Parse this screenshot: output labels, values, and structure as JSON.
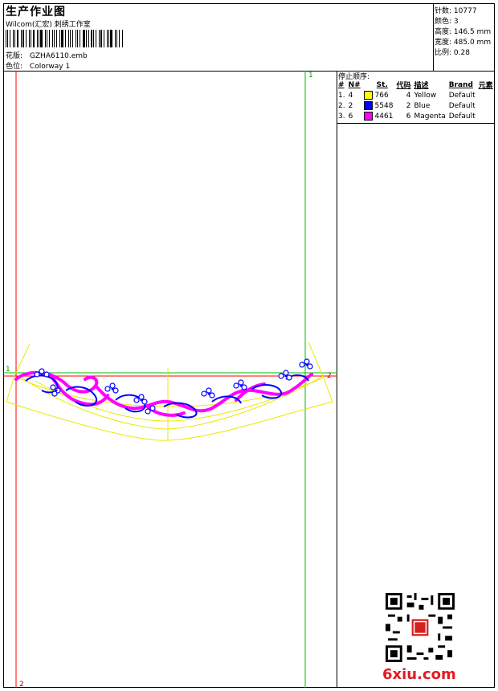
{
  "header": {
    "title": "生产作业图",
    "company": "Wilcom(汇宏) 刺绣工作室",
    "design_label": "花版:",
    "design_value": "GZHA6110.emb",
    "colorway_label": "色位:",
    "colorway_value": "Colorway 1"
  },
  "stats": [
    {
      "label": "针数:",
      "value": "10777"
    },
    {
      "label": "颜色:",
      "value": "3"
    },
    {
      "label": "高度:",
      "value": "146.5 mm"
    },
    {
      "label": "宽度:",
      "value": "485.0 mm"
    },
    {
      "label": "比例:",
      "value": "0.28"
    }
  ],
  "stop_sequence": {
    "title": "停止顺序:",
    "columns": [
      "#",
      "N#",
      "St.",
      "代码",
      "描述",
      "Brand",
      "元素"
    ],
    "rows": [
      {
        "idx": "1.",
        "n": "4",
        "st": "766",
        "code": "4",
        "desc": "Yellow",
        "brand": "Default",
        "color": "#ffff00"
      },
      {
        "idx": "2.",
        "n": "2",
        "st": "5548",
        "code": "2",
        "desc": "Blue",
        "brand": "Default",
        "color": "#0000ff"
      },
      {
        "idx": "3.",
        "n": "6",
        "st": "4461",
        "code": "6",
        "desc": "Magenta",
        "brand": "Default",
        "color": "#ff00ff"
      }
    ]
  },
  "guides": {
    "label_top": "1",
    "label_left": "1",
    "label_right": "2",
    "label_bottom": "2"
  },
  "colors": {
    "red_guide": "#ff0000",
    "green_guide": "#00c000",
    "outline_yellow": "#e8e800",
    "stitch_blue": "#0000ff",
    "stitch_magenta": "#ff00ff"
  },
  "watermark": "6xiu.com"
}
